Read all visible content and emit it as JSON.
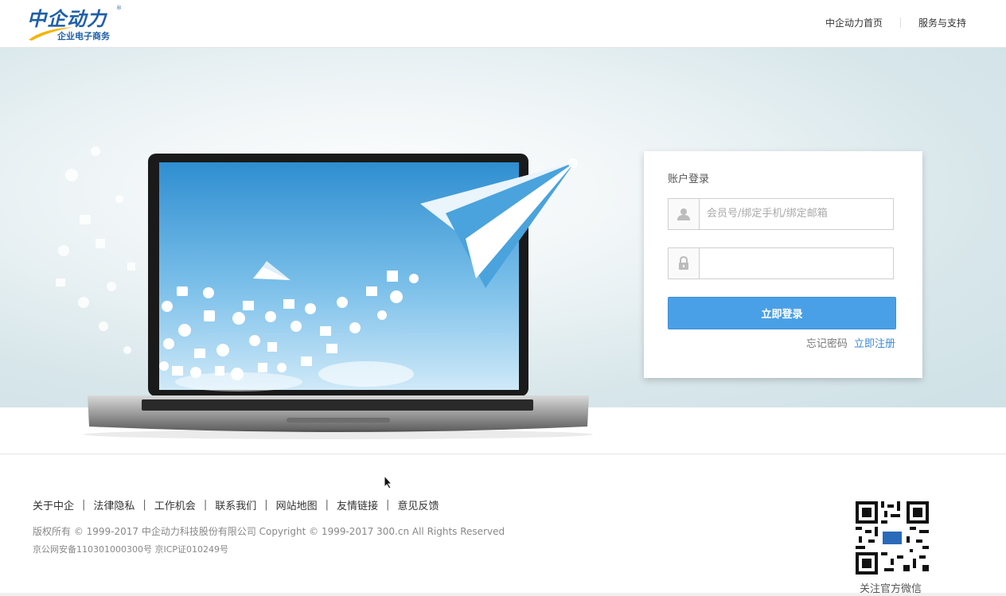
{
  "header": {
    "logo": {
      "main": "中企动力",
      "sub": "企业电子商务",
      "reg": "®"
    },
    "nav": [
      {
        "label": "中企动力首页"
      },
      {
        "label": "服务与支持"
      }
    ]
  },
  "login": {
    "title": "账户登录",
    "username": {
      "placeholder": "会员号/绑定手机/绑定邮箱",
      "value": ""
    },
    "password": {
      "placeholder": "",
      "value": ""
    },
    "submit_label": "立即登录",
    "forget_label": "忘记密码",
    "register_label": "立即注册"
  },
  "footer": {
    "links": [
      {
        "label": "关于中企"
      },
      {
        "label": "法律隐私"
      },
      {
        "label": "工作机会"
      },
      {
        "label": "联系我们"
      },
      {
        "label": "网站地图"
      },
      {
        "label": "友情链接"
      },
      {
        "label": "意见反馈"
      }
    ],
    "separator": "|",
    "copyright": "版权所有 © 1999-2017 中企动力科技股份有限公司 Copyright © 1999-2017 300.cn All Rights Reserved",
    "icp": "京公网安备110301000300号 京ICP证010249号",
    "qr_label": "关注官方微信"
  },
  "colors": {
    "brand": "#1f5fa8",
    "button": "#4aa0e6",
    "link": "#3a8ad6",
    "banner": "#d7e6ea"
  }
}
